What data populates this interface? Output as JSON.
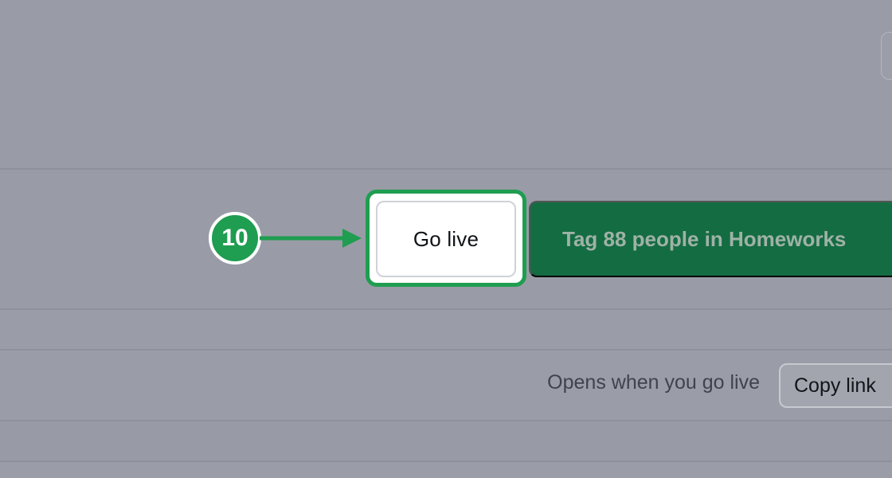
{
  "annotation": {
    "step_number": "10",
    "highlight_color": "#1f9d50"
  },
  "actions": {
    "go_live_label": "Go live",
    "tag_people_label": "Tag 88 people in Homeworks",
    "primary_color": "#146c43"
  },
  "share": {
    "hint": "Opens when you go live",
    "copy_link_label": "Copy link"
  }
}
